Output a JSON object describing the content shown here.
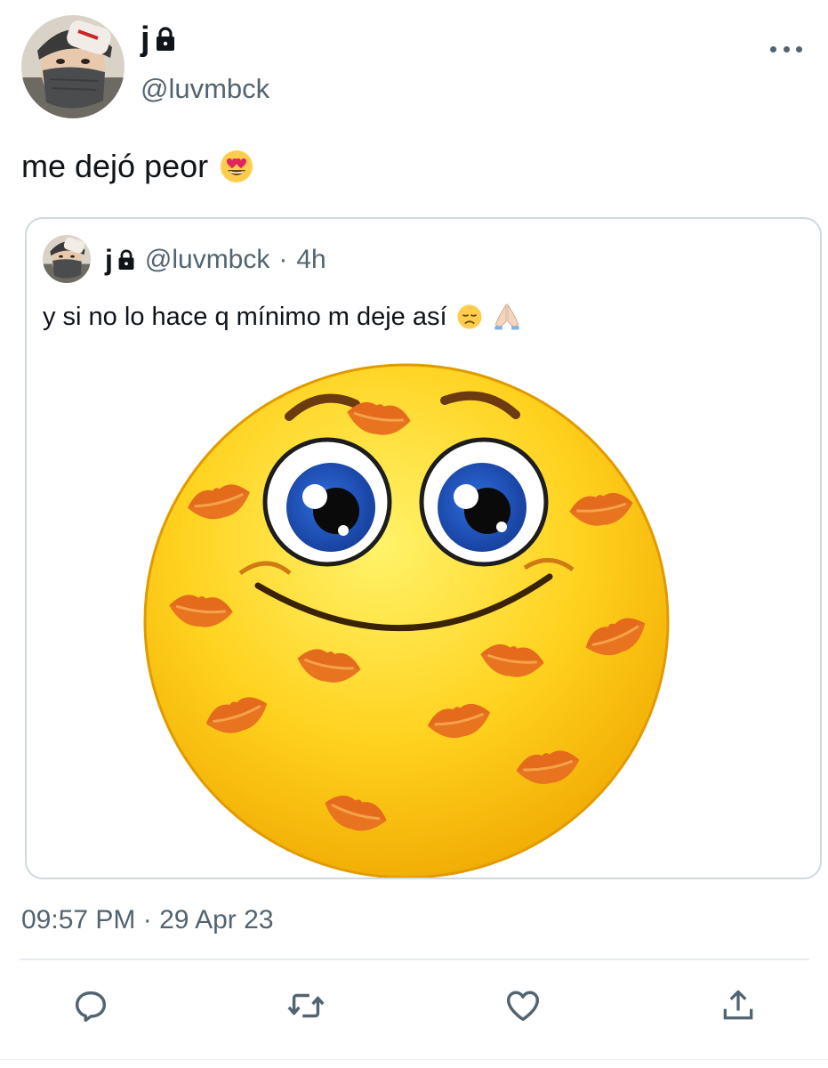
{
  "tweet": {
    "display_name": "j",
    "handle": "@luvmbck",
    "text": "me dejó peor",
    "text_emoji": "heart-eyes-emoji",
    "timestamp": "09:57 PM · 29 Apr 23"
  },
  "quote": {
    "display_name": "j",
    "handle": "@luvmbck",
    "separator": "·",
    "time": "4h",
    "text": "y si no lo hace q mínimo m deje así",
    "text_emojis": [
      "disappointed-face-emoji",
      "folded-hands-emoji"
    ],
    "media": "smiley-with-lipstick-kisses-image"
  },
  "actions": [
    "reply-icon",
    "retweet-icon",
    "like-icon",
    "share-icon"
  ],
  "colors": {
    "text": "#0f1419",
    "secondary": "#536471",
    "border": "#cfd9de",
    "divider": "#e6ecf0"
  }
}
